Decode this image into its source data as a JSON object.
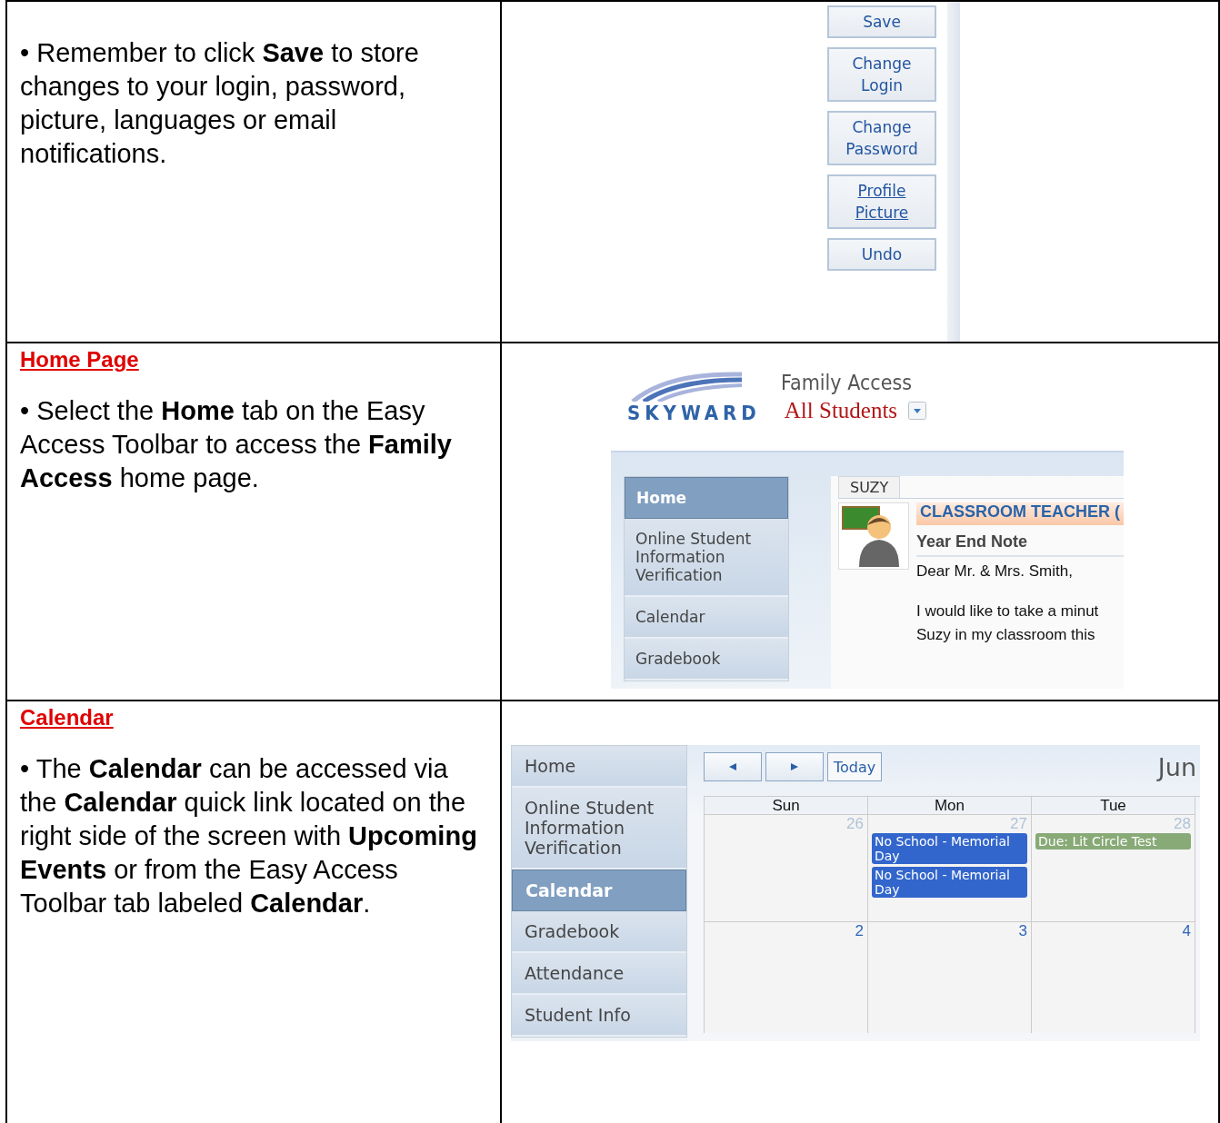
{
  "sections": [
    {
      "kind": "account_buttons",
      "paragraph": "• Remember to click **Save** to store changes to your login, password, picture, languages or email notifications.",
      "buttons": [
        {
          "label": "Save",
          "link": false
        },
        {
          "label": "Change Login",
          "link": false
        },
        {
          "label": "Change Password",
          "link": false
        },
        {
          "label": "Profile Picture",
          "link": true
        },
        {
          "label": "Undo",
          "link": false
        }
      ]
    },
    {
      "kind": "home_page",
      "heading": "Home Page",
      "paragraph": "• Select the **Home** tab on the Easy Access Toolbar to access the **Family Access** home page.",
      "logo": "SKYWARD",
      "app_title": "Family Access",
      "student_selector": "All Students",
      "nav": [
        {
          "label": "Home",
          "selected": true
        },
        {
          "label": "Online Student Information Verification",
          "selected": false
        },
        {
          "label": "Calendar",
          "selected": false
        },
        {
          "label": "Gradebook",
          "selected": false
        }
      ],
      "tab": "SUZY",
      "card_title": "CLASSROOM TEACHER (",
      "card_subject": "Year End Note",
      "message_lines": [
        "Dear Mr. & Mrs. Smith,",
        "I would like to take a minut",
        "Suzy in my classroom this"
      ]
    },
    {
      "kind": "calendar",
      "heading": "Calendar",
      "paragraph": "• The **Calendar** can be accessed via the **Calendar** quick link located on the right side of the screen with **Upcoming Events** or from the Easy Access Toolbar tab labeled **Calendar**.",
      "nav": [
        {
          "label": "Home",
          "selected": false
        },
        {
          "label": "Online Student Information Verification",
          "selected": false
        },
        {
          "label": "Calendar",
          "selected": true
        },
        {
          "label": "Gradebook",
          "selected": false
        },
        {
          "label": "Attendance",
          "selected": false
        },
        {
          "label": "Student Info",
          "selected": false
        }
      ],
      "today_button": "Today",
      "month": "Jun",
      "days": [
        "Sun",
        "Mon",
        "Tue"
      ],
      "weeks": [
        [
          {
            "date": "26",
            "other_month": true
          },
          {
            "date": "27",
            "other_month": true,
            "events": [
              {
                "label": "No School - Memorial Day",
                "color": "#3366cc"
              },
              {
                "label": "No School - Memorial Day",
                "color": "#3366cc"
              }
            ]
          },
          {
            "date": "28",
            "other_month": true,
            "events": [
              {
                "label": "Due: Lit Circle Test",
                "color": "#88aa77"
              }
            ]
          }
        ],
        [
          {
            "date": "2",
            "other_month": false
          },
          {
            "date": "3",
            "other_month": false
          },
          {
            "date": "4",
            "other_month": false
          }
        ]
      ]
    }
  ]
}
